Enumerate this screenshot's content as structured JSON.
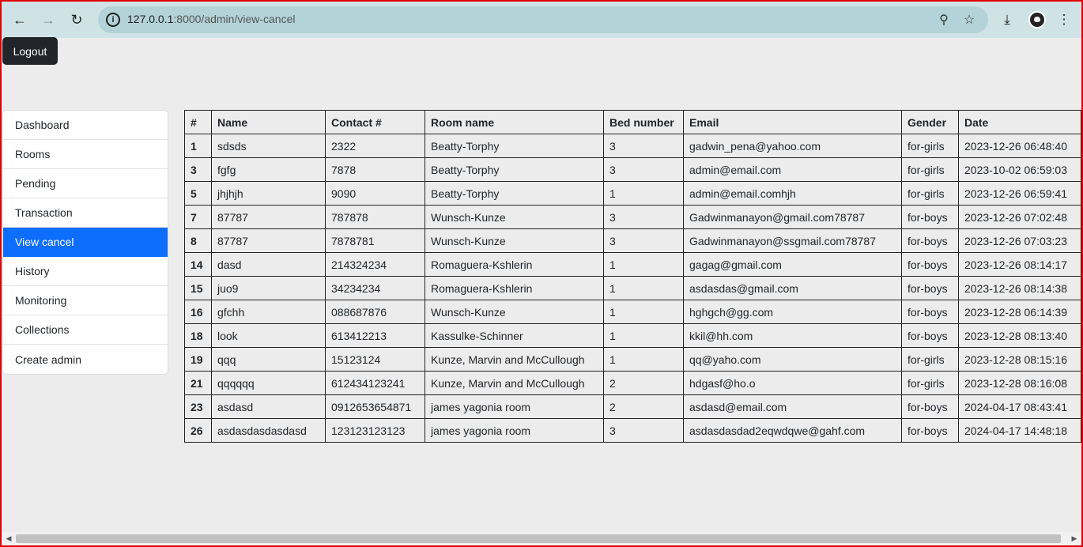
{
  "browser": {
    "url_host": "127.0.0.1",
    "url_path": ":8000/admin/view-cancel",
    "icons": {
      "back": "back-arrow-icon",
      "forward": "forward-arrow-icon",
      "reload": "reload-icon",
      "info": "site-info-icon",
      "zoom": "zoom-icon",
      "bookmark": "star-icon",
      "download": "download-icon",
      "profile": "avatar",
      "menu": "kebab-menu-icon"
    }
  },
  "header": {
    "logout_label": "Logout"
  },
  "sidebar": {
    "items": [
      {
        "label": "Dashboard",
        "active": false
      },
      {
        "label": "Rooms",
        "active": false
      },
      {
        "label": "Pending",
        "active": false
      },
      {
        "label": "Transaction",
        "active": false
      },
      {
        "label": "View cancel",
        "active": true
      },
      {
        "label": "History",
        "active": false
      },
      {
        "label": "Monitoring",
        "active": false
      },
      {
        "label": "Collections",
        "active": false
      },
      {
        "label": "Create admin",
        "active": false
      }
    ]
  },
  "table": {
    "columns": [
      "#",
      "Name",
      "Contact #",
      "Room name",
      "Bed number",
      "Email",
      "Gender",
      "Date"
    ],
    "rows": [
      [
        "1",
        "sdsds",
        "2322",
        "Beatty-Torphy",
        "3",
        "gadwin_pena@yahoo.com",
        "for-girls",
        "2023-12-26 06:48:40"
      ],
      [
        "3",
        "fgfg",
        "7878",
        "Beatty-Torphy",
        "3",
        "admin@email.com",
        "for-girls",
        "2023-10-02 06:59:03"
      ],
      [
        "5",
        "jhjhjh",
        "9090",
        "Beatty-Torphy",
        "1",
        "admin@email.comhjh",
        "for-girls",
        "2023-12-26 06:59:41"
      ],
      [
        "7",
        "87787",
        "787878",
        "Wunsch-Kunze",
        "3",
        "Gadwinmanayon@gmail.com78787",
        "for-boys",
        "2023-12-26 07:02:48"
      ],
      [
        "8",
        "87787",
        "7878781",
        "Wunsch-Kunze",
        "3",
        "Gadwinmanayon@ssgmail.com78787",
        "for-boys",
        "2023-12-26 07:03:23"
      ],
      [
        "14",
        "dasd",
        "214324234",
        "Romaguera-Kshlerin",
        "1",
        "gagag@gmail.com",
        "for-boys",
        "2023-12-26 08:14:17"
      ],
      [
        "15",
        "juo9",
        "34234234",
        "Romaguera-Kshlerin",
        "1",
        "asdasdas@gmail.com",
        "for-boys",
        "2023-12-26 08:14:38"
      ],
      [
        "16",
        "gfchh",
        "088687876",
        "Wunsch-Kunze",
        "1",
        "hghgch@gg.com",
        "for-boys",
        "2023-12-28 06:14:39"
      ],
      [
        "18",
        "look",
        "613412213",
        "Kassulke-Schinner",
        "1",
        "kkil@hh.com",
        "for-boys",
        "2023-12-28 08:13:40"
      ],
      [
        "19",
        "qqq",
        "15123124",
        "Kunze, Marvin and McCullough",
        "1",
        "qq@yaho.com",
        "for-girls",
        "2023-12-28 08:15:16"
      ],
      [
        "21",
        "qqqqqq",
        "612434123241",
        "Kunze, Marvin and McCullough",
        "2",
        "hdgasf@ho.o",
        "for-girls",
        "2023-12-28 08:16:08"
      ],
      [
        "23",
        "asdasd",
        "0912653654871",
        "james yagonia room",
        "2",
        "asdasd@email.com",
        "for-boys",
        "2024-04-17 08:43:41"
      ],
      [
        "26",
        "asdasdasdasdasd",
        "123123123123",
        "james yagonia room",
        "3",
        "asdasdasdad2eqwdqwe@gahf.com",
        "for-boys",
        "2024-04-17 14:48:18"
      ]
    ]
  }
}
